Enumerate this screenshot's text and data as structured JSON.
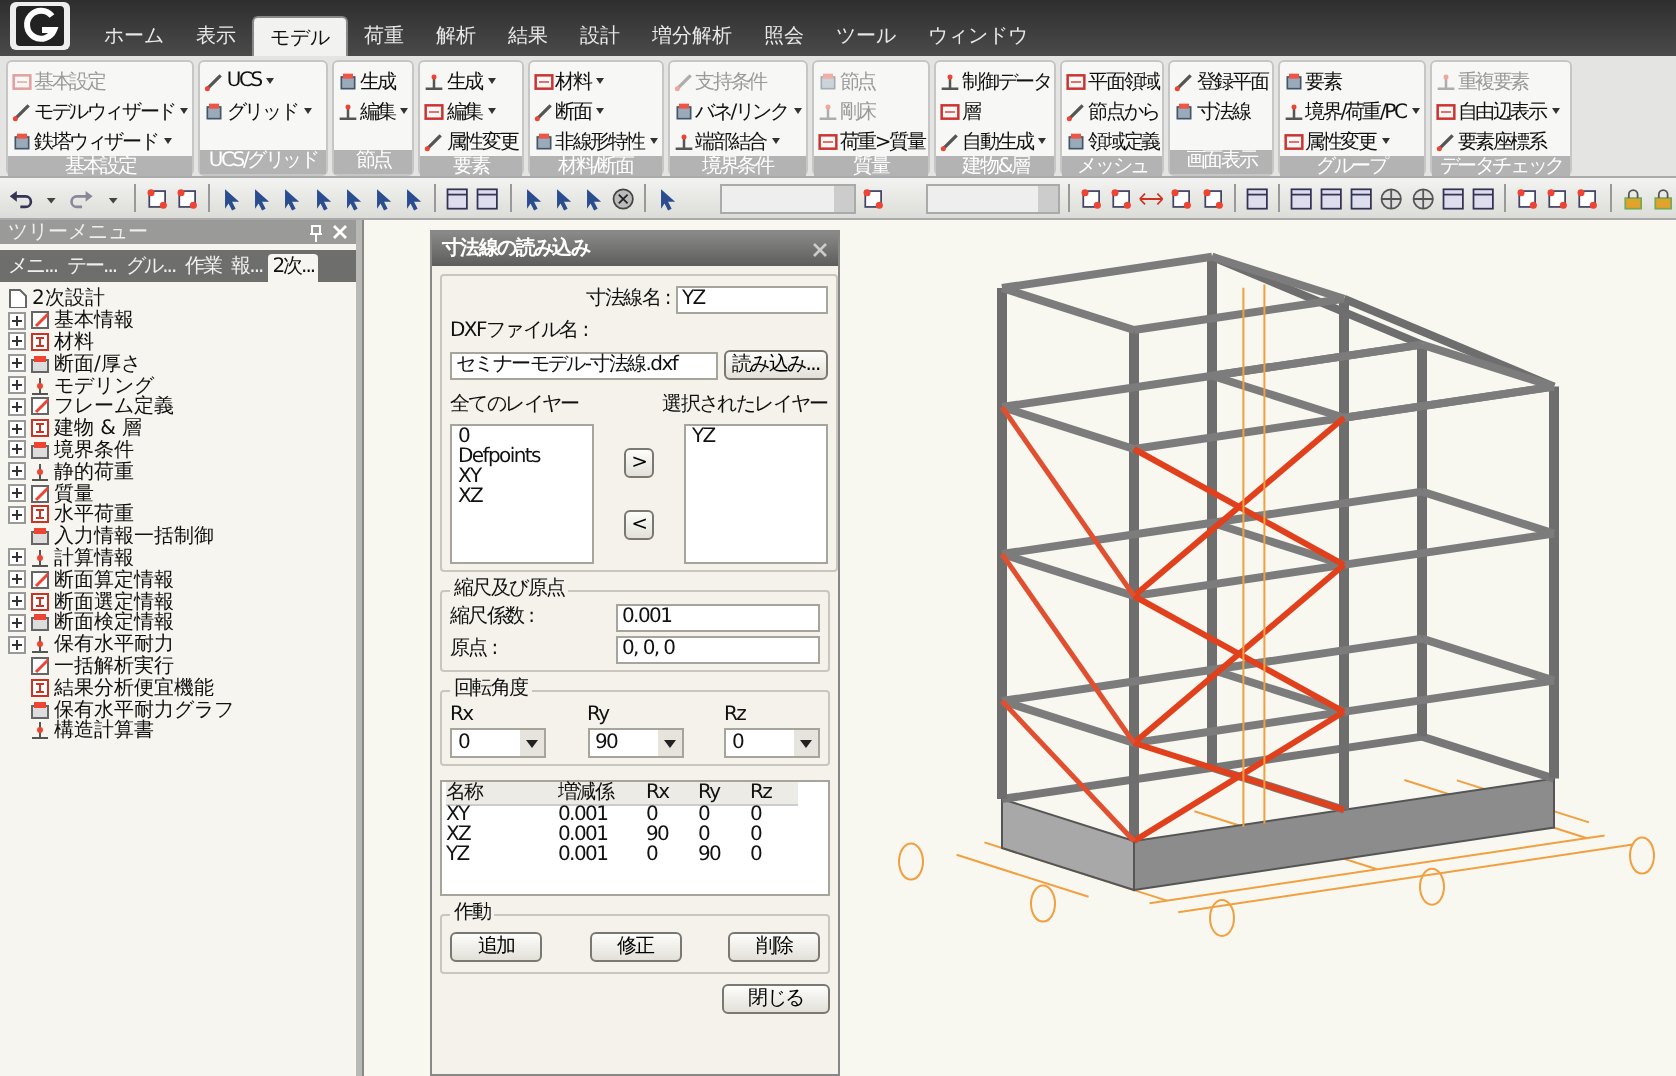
{
  "menu_tabs": [
    {
      "label": "ホーム",
      "selected": false
    },
    {
      "label": "表示",
      "selected": false
    },
    {
      "label": "モデル",
      "selected": true
    },
    {
      "label": "荷重",
      "selected": false
    },
    {
      "label": "解析",
      "selected": false
    },
    {
      "label": "結果",
      "selected": false
    },
    {
      "label": "設計",
      "selected": false
    },
    {
      "label": "増分解析",
      "selected": false
    },
    {
      "label": "照会",
      "selected": false
    },
    {
      "label": "ツール",
      "selected": false
    },
    {
      "label": "ウィンドウ",
      "selected": false
    }
  ],
  "ribbon": {
    "groups": [
      {
        "label": "基本設定",
        "items": [
          {
            "label": "基本設定",
            "disabled": true,
            "dropdown": false
          },
          {
            "label": "モデルウィザード",
            "disabled": false,
            "dropdown": true
          },
          {
            "label": "鉄塔ウィザード",
            "disabled": false,
            "dropdown": true
          }
        ]
      },
      {
        "label": "UCS/グリッド",
        "items": [
          {
            "label": "UCS",
            "disabled": false,
            "dropdown": true
          },
          {
            "label": "グリッド",
            "disabled": false,
            "dropdown": true
          }
        ]
      },
      {
        "label": "節点",
        "items": [
          {
            "label": "生成",
            "disabled": false,
            "dropdown": false
          },
          {
            "label": "編集",
            "disabled": false,
            "dropdown": true
          }
        ]
      },
      {
        "label": "要素",
        "items": [
          {
            "label": "生成",
            "disabled": false,
            "dropdown": true
          },
          {
            "label": "編集",
            "disabled": false,
            "dropdown": true
          },
          {
            "label": "属性変更",
            "disabled": false,
            "dropdown": false
          }
        ]
      },
      {
        "label": "材料/断面",
        "items": [
          {
            "label": "材料",
            "disabled": false,
            "dropdown": true
          },
          {
            "label": "断面",
            "disabled": false,
            "dropdown": true
          },
          {
            "label": "非線形特性",
            "disabled": false,
            "dropdown": true
          }
        ]
      },
      {
        "label": "境界条件",
        "items": [
          {
            "label": "支持条件",
            "disabled": true,
            "dropdown": false
          },
          {
            "label": "バネ/リンク",
            "disabled": false,
            "dropdown": true
          },
          {
            "label": "端部結合",
            "disabled": false,
            "dropdown": true
          }
        ]
      },
      {
        "label": "質量",
        "items": [
          {
            "label": "節点",
            "disabled": true,
            "dropdown": false
          },
          {
            "label": "剛床",
            "disabled": true,
            "dropdown": false
          },
          {
            "label": "荷重>質量",
            "disabled": false,
            "dropdown": false
          }
        ]
      },
      {
        "label": "建物&層",
        "items": [
          {
            "label": "制御データ",
            "disabled": false,
            "dropdown": false
          },
          {
            "label": "層",
            "disabled": false,
            "dropdown": false
          },
          {
            "label": "自動生成",
            "disabled": false,
            "dropdown": true
          }
        ]
      },
      {
        "label": "メッシュ",
        "items": [
          {
            "label": "平面領域",
            "disabled": false,
            "dropdown": false
          },
          {
            "label": "節点から",
            "disabled": false,
            "dropdown": false
          },
          {
            "label": "領域定義",
            "disabled": false,
            "dropdown": false
          }
        ]
      },
      {
        "label": "画面表示",
        "items": [
          {
            "label": "登録平面",
            "disabled": false,
            "dropdown": false
          },
          {
            "label": "寸法線",
            "disabled": false,
            "dropdown": false
          }
        ]
      },
      {
        "label": "グループ",
        "items": [
          {
            "label": "要素",
            "disabled": false,
            "dropdown": false
          },
          {
            "label": "境界/荷重/PC",
            "disabled": false,
            "dropdown": true
          },
          {
            "label": "属性変更",
            "disabled": false,
            "dropdown": true
          }
        ]
      },
      {
        "label": "データチェック",
        "items": [
          {
            "label": "重複要素",
            "disabled": true,
            "dropdown": false
          },
          {
            "label": "自由辺表示",
            "disabled": false,
            "dropdown": true
          },
          {
            "label": "要素座標系",
            "disabled": false,
            "dropdown": false
          }
        ]
      }
    ]
  },
  "tree_panel": {
    "title": "ツリーメニュー",
    "tabs": [
      {
        "label": "メニ...",
        "selected": false
      },
      {
        "label": "テー...",
        "selected": false
      },
      {
        "label": "グル...",
        "selected": false
      },
      {
        "label": "作業",
        "selected": false
      },
      {
        "label": "報...",
        "selected": false
      },
      {
        "label": "2次...",
        "selected": true
      }
    ],
    "root": {
      "label": "2次設計",
      "children": [
        {
          "label": "基本情報",
          "kind": "group",
          "expanded": false
        },
        {
          "label": "材料",
          "kind": "group",
          "expanded": false
        },
        {
          "label": "断面/厚さ",
          "kind": "group",
          "expanded": false
        },
        {
          "label": "モデリング",
          "kind": "group",
          "expanded": false
        },
        {
          "label": "フレーム定義",
          "kind": "group",
          "expanded": false
        },
        {
          "label": "建物 & 層",
          "kind": "group",
          "expanded": false
        },
        {
          "label": "境界条件",
          "kind": "group",
          "expanded": false
        },
        {
          "label": "静的荷重",
          "kind": "group",
          "expanded": false
        },
        {
          "label": "質量",
          "kind": "group",
          "expanded": false
        },
        {
          "label": "水平荷重",
          "kind": "group",
          "expanded": false
        },
        {
          "label": "入力情報一括制御",
          "kind": "leaf"
        },
        {
          "label": "計算情報",
          "kind": "group",
          "expanded": false
        },
        {
          "label": "断面算定情報",
          "kind": "group",
          "expanded": false
        },
        {
          "label": "断面選定情報",
          "kind": "group",
          "expanded": false
        },
        {
          "label": "断面検定情報",
          "kind": "group",
          "expanded": false
        },
        {
          "label": "保有水平耐力",
          "kind": "group",
          "expanded": false
        },
        {
          "label": "一括解析実行",
          "kind": "leaf"
        },
        {
          "label": "結果分析便宜機能",
          "kind": "leaf"
        },
        {
          "label": "保有水平耐力グラフ",
          "kind": "leaf"
        },
        {
          "label": "構造計算書",
          "kind": "leaf"
        }
      ]
    }
  },
  "dialog": {
    "title": "寸法線の読み込み",
    "name_label": "寸法線名 :",
    "name_value": "YZ",
    "file_label": "DXFファイル名 :",
    "file_value": "セミナーモデル-寸法線.dxf",
    "load_button": "読み込み...",
    "all_layers_label": "全てのレイヤー",
    "all_layers": [
      "0",
      "Defpoints",
      "XY",
      "XZ"
    ],
    "selected_layers_label": "選択されたレイヤー",
    "selected_layers": [
      "YZ"
    ],
    "add_button": ">",
    "remove_button": "<",
    "scale_group": {
      "title": "縮尺及び原点",
      "fields": [
        {
          "label": "縮尺係数 :",
          "value": "0.001"
        },
        {
          "label": "原点 :",
          "value": "0, 0, 0"
        }
      ]
    },
    "rotation_group": {
      "title": "回転角度",
      "combos": [
        {
          "label": "Rx",
          "value": "0"
        },
        {
          "label": "Ry",
          "value": "90"
        },
        {
          "label": "Rz",
          "value": "0"
        }
      ]
    },
    "table": {
      "columns": [
        "名称",
        "増減係",
        "Rx",
        "Ry",
        "Rz"
      ],
      "rows": [
        [
          "XY",
          "0.001",
          "0",
          "0",
          "0"
        ],
        [
          "XZ",
          "0.001",
          "90",
          "0",
          "0"
        ],
        [
          "YZ",
          "0.001",
          "0",
          "90",
          "0"
        ]
      ]
    },
    "action_group": {
      "title": "作動",
      "buttons": [
        "追加",
        "修正",
        "削除"
      ]
    },
    "close_button": "閉じる"
  }
}
